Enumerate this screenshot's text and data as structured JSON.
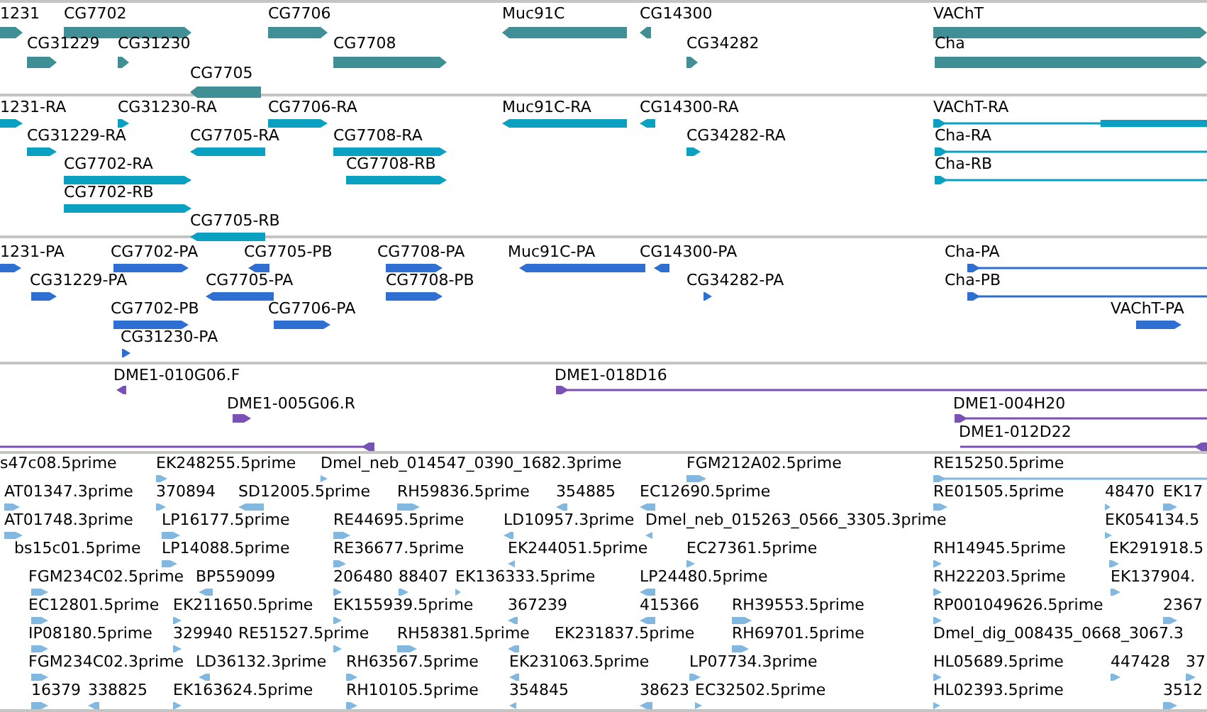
{
  "tracks": [
    {
      "kind": "gene",
      "features": [
        {
          "label": "1231",
          "reverse": false
        },
        {
          "label": "CG7702",
          "reverse": false
        },
        {
          "label": "CG7706",
          "reverse": false
        },
        {
          "label": "Muc91C",
          "reverse": true
        },
        {
          "label": "CG14300",
          "reverse": true
        },
        {
          "label": "VAChT",
          "reverse": false
        },
        {
          "label": "CG31229",
          "reverse": false
        },
        {
          "label": "CG31230",
          "reverse": false
        },
        {
          "label": "CG7708",
          "reverse": false
        },
        {
          "label": "CG34282",
          "reverse": false
        },
        {
          "label": "Cha",
          "reverse": false
        },
        {
          "label": "CG7705",
          "reverse": true
        }
      ]
    },
    {
      "kind": "transcript",
      "features": [
        {
          "label": "1231-RA",
          "reverse": false
        },
        {
          "label": "CG31230-RA",
          "reverse": false
        },
        {
          "label": "CG7706-RA",
          "reverse": false
        },
        {
          "label": "Muc91C-RA",
          "reverse": true
        },
        {
          "label": "CG14300-RA",
          "reverse": true
        },
        {
          "label": "VAChT-RA",
          "reverse": false
        },
        {
          "label": "CG31229-RA",
          "reverse": false
        },
        {
          "label": "CG7705-RA",
          "reverse": true
        },
        {
          "label": "CG7708-RA",
          "reverse": false
        },
        {
          "label": "CG34282-RA",
          "reverse": false
        },
        {
          "label": "Cha-RA",
          "reverse": false
        },
        {
          "label": "CG7702-RA",
          "reverse": false
        },
        {
          "label": "CG7708-RB",
          "reverse": false
        },
        {
          "label": "Cha-RB",
          "reverse": false
        },
        {
          "label": "CG7702-RB",
          "reverse": false
        },
        {
          "label": "CG7705-RB",
          "reverse": true
        }
      ]
    },
    {
      "kind": "protein",
      "features": [
        {
          "label": "1231-PA",
          "reverse": false
        },
        {
          "label": "CG7702-PA",
          "reverse": false
        },
        {
          "label": "CG7705-PB",
          "reverse": true
        },
        {
          "label": "CG7708-PA",
          "reverse": false
        },
        {
          "label": "Muc91C-PA",
          "reverse": true
        },
        {
          "label": "CG14300-PA",
          "reverse": true
        },
        {
          "label": "Cha-PA",
          "reverse": false
        },
        {
          "label": "CG31229-PA",
          "reverse": false
        },
        {
          "label": "CG7705-PA",
          "reverse": true
        },
        {
          "label": "CG7708-PB",
          "reverse": false
        },
        {
          "label": "CG34282-PA",
          "reverse": false
        },
        {
          "label": "Cha-PB",
          "reverse": false
        },
        {
          "label": "CG7702-PB",
          "reverse": false
        },
        {
          "label": "CG7706-PA",
          "reverse": false
        },
        {
          "label": "VAChT-PA",
          "reverse": false
        },
        {
          "label": "CG31230-PA",
          "reverse": false
        }
      ]
    },
    {
      "kind": "clone",
      "features": [
        {
          "label": "DME1-010G06.F",
          "reverse": true
        },
        {
          "label": "DME1-018D16",
          "reverse": false
        },
        {
          "label": "DME1-005G06.R",
          "reverse": false
        },
        {
          "label": "DME1-004H20",
          "reverse": false
        },
        {
          "reverse": true
        },
        {
          "label": "DME1-012D22",
          "reverse": true
        }
      ]
    },
    {
      "kind": "est",
      "features": [
        {
          "label": "s47c08.5prime"
        },
        {
          "label": "EK248255.5prime",
          "reverse": false
        },
        {
          "label": "Dmel_neb_014547_0390_1682.3prime",
          "reverse": false
        },
        {
          "label": "FGM212A02.5prime",
          "reverse": false
        },
        {
          "label": "RE15250.5prime",
          "reverse": false
        },
        {
          "label": "AT01347.3prime",
          "reverse": false
        },
        {
          "label": "370894",
          "reverse": false
        },
        {
          "label": "SD12005.5prime",
          "reverse": true
        },
        {
          "label": "RH59836.5prime",
          "reverse": false
        },
        {
          "label": "354885",
          "reverse": true
        },
        {
          "label": "EC12690.5prime",
          "reverse": true
        },
        {
          "label": "RE01505.5prime",
          "reverse": false
        },
        {
          "label": "48470",
          "reverse": false
        },
        {
          "label": "EK17",
          "reverse": false
        },
        {
          "label": "AT01748.3prime",
          "reverse": false
        },
        {
          "label": "LP16177.5prime",
          "reverse": false
        },
        {
          "label": "RE44695.5prime",
          "reverse": false
        },
        {
          "label": "LD10957.3prime",
          "reverse": true
        },
        {
          "label": "Dmel_neb_015263_0566_3305.3prime",
          "reverse": true
        },
        {
          "label": "EK054134.5",
          "reverse": false
        },
        {
          "label": "bs15c01.5prime"
        },
        {
          "label": "LP14088.5prime",
          "reverse": false
        },
        {
          "label": "RE36677.5prime",
          "reverse": false
        },
        {
          "label": "EK244051.5prime",
          "reverse": true
        },
        {
          "label": "EC27361.5prime",
          "reverse": false
        },
        {
          "label": "RH14945.5prime",
          "reverse": false
        },
        {
          "label": "EK291918.5",
          "reverse": false
        },
        {
          "label": "FGM234C02.5prime",
          "reverse": false
        },
        {
          "label": "BP559099",
          "reverse": true
        },
        {
          "label": "206480",
          "reverse": false
        },
        {
          "label": "88407",
          "reverse": false
        },
        {
          "label": "EK136333.5prime",
          "reverse": false
        },
        {
          "label": "LP24480.5prime",
          "reverse": true
        },
        {
          "label": "RH22203.5prime",
          "reverse": false
        },
        {
          "label": "EK137904.",
          "reverse": false
        },
        {
          "label": "EC12801.5prime",
          "reverse": false
        },
        {
          "label": "EK211650.5prime",
          "reverse": false
        },
        {
          "label": "EK155939.5prime",
          "reverse": false
        },
        {
          "label": "367239",
          "reverse": true
        },
        {
          "label": "415366",
          "reverse": true
        },
        {
          "label": "RH39553.5prime",
          "reverse": false
        },
        {
          "label": "RP001049626.5prime",
          "reverse": false
        },
        {
          "label": "2367",
          "reverse": false
        },
        {
          "label": "IP08180.5prime",
          "reverse": false
        },
        {
          "label": "329940",
          "reverse": false
        },
        {
          "label": "RE51527.5prime",
          "reverse": false
        },
        {
          "label": "RH58381.5prime",
          "reverse": false
        },
        {
          "label": "EK231837.5prime",
          "reverse": true
        },
        {
          "label": "RH69701.5prime",
          "reverse": false
        },
        {
          "label": "Dmel_dig_008435_0668_3067.3"
        },
        {
          "label": "FGM234C02.3prime",
          "reverse": false
        },
        {
          "label": "LD36132.3prime",
          "reverse": true
        },
        {
          "label": "RH63567.5prime",
          "reverse": false
        },
        {
          "label": "EK231063.5prime",
          "reverse": true
        },
        {
          "label": "LP07734.3prime",
          "reverse": false
        },
        {
          "label": "HL05689.5prime",
          "reverse": false
        },
        {
          "label": "447428",
          "reverse": false
        },
        {
          "label": "37",
          "reverse": false
        },
        {
          "label": "16379",
          "reverse": false
        },
        {
          "label": "338825",
          "reverse": true
        },
        {
          "label": "EK163624.5prime",
          "reverse": false
        },
        {
          "label": "RH10105.5prime",
          "reverse": false
        },
        {
          "label": "354845",
          "reverse": true
        },
        {
          "label": "38623",
          "reverse": true
        },
        {
          "label": "EC32502.5prime",
          "reverse": false
        },
        {
          "label": "HL02393.5prime",
          "reverse": false
        },
        {
          "label": "3512",
          "reverse": false
        }
      ]
    }
  ]
}
